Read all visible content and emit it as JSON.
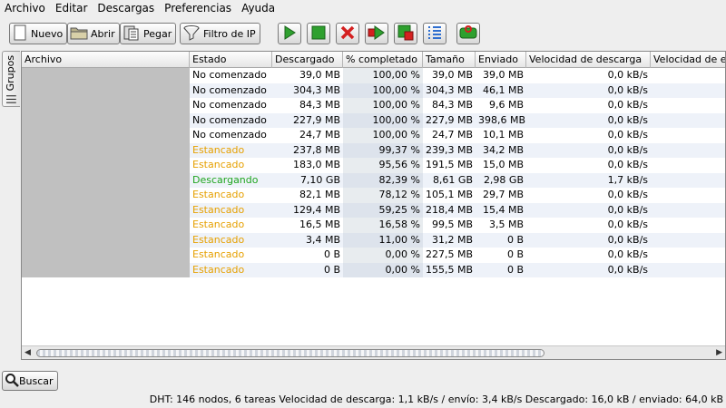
{
  "menu": {
    "items": [
      {
        "label": "Archivo"
      },
      {
        "label": "Editar"
      },
      {
        "label": "Descargas"
      },
      {
        "label": "Preferencias"
      },
      {
        "label": "Ayuda"
      }
    ]
  },
  "toolbar": {
    "new_label": "Nuevo",
    "open_label": "Abrir",
    "paste_label": "Pegar",
    "ipfilter_label": "Filtro de IP",
    "icons": [
      "start-icon",
      "stop-icon",
      "remove-icon",
      "step-icon",
      "pause-icon",
      "details-icon",
      "on-off-icon"
    ]
  },
  "side_tab": {
    "label": "Grupos"
  },
  "table": {
    "columns": [
      "Archivo",
      "Estado",
      "Descargado",
      "% completado",
      "Tamaño",
      "Enviado",
      "Velocidad de descarga",
      "Velocidad de e"
    ],
    "rows": [
      {
        "file": "",
        "status": "No comenzado",
        "status_type": "idle",
        "downloaded": "39,0 MB",
        "pct": "100,00 %",
        "size": "39,0 MB",
        "sent": "39,0 MB",
        "dlspeed": "0,0 kB/s",
        "ulspeed": "0,"
      },
      {
        "file": "",
        "status": "No comenzado",
        "status_type": "idle",
        "downloaded": "304,3 MB",
        "pct": "100,00 %",
        "size": "304,3 MB",
        "sent": "46,1 MB",
        "dlspeed": "0,0 kB/s",
        "ulspeed": "0,"
      },
      {
        "file": "",
        "status": "No comenzado",
        "status_type": "idle",
        "downloaded": "84,3 MB",
        "pct": "100,00 %",
        "size": "84,3 MB",
        "sent": "9,6 MB",
        "dlspeed": "0,0 kB/s",
        "ulspeed": "0,"
      },
      {
        "file": "",
        "status": "No comenzado",
        "status_type": "idle",
        "downloaded": "227,9 MB",
        "pct": "100,00 %",
        "size": "227,9 MB",
        "sent": "398,6 MB",
        "dlspeed": "0,0 kB/s",
        "ulspeed": "0,"
      },
      {
        "file": "",
        "status": "No comenzado",
        "status_type": "idle",
        "downloaded": "24,7 MB",
        "pct": "100,00 %",
        "size": "24,7 MB",
        "sent": "10,1 MB",
        "dlspeed": "0,0 kB/s",
        "ulspeed": "0,"
      },
      {
        "file": "",
        "status": "Estancado",
        "status_type": "stalled",
        "downloaded": "237,8 MB",
        "pct": "99,37 %",
        "size": "239,3 MB",
        "sent": "34,2 MB",
        "dlspeed": "0,0 kB/s",
        "ulspeed": "0,"
      },
      {
        "file": "",
        "status": "Estancado",
        "status_type": "stalled",
        "downloaded": "183,0 MB",
        "pct": "95,56 %",
        "size": "191,5 MB",
        "sent": "15,0 MB",
        "dlspeed": "0,0 kB/s",
        "ulspeed": "0,"
      },
      {
        "file": "",
        "status": "Descargando",
        "status_type": "down",
        "downloaded": "7,10 GB",
        "pct": "82,39 %",
        "size": "8,61 GB",
        "sent": "2,98 GB",
        "dlspeed": "1,7 kB/s",
        "ulspeed": "3,"
      },
      {
        "file": "",
        "status": "Estancado",
        "status_type": "stalled",
        "downloaded": "82,1 MB",
        "pct": "78,12 %",
        "size": "105,1 MB",
        "sent": "29,7 MB",
        "dlspeed": "0,0 kB/s",
        "ulspeed": "0,"
      },
      {
        "file": "",
        "status": "Estancado",
        "status_type": "stalled",
        "downloaded": "129,4 MB",
        "pct": "59,25 %",
        "size": "218,4 MB",
        "sent": "15,4 MB",
        "dlspeed": "0,0 kB/s",
        "ulspeed": "0,"
      },
      {
        "file": "",
        "status": "Estancado",
        "status_type": "stalled",
        "downloaded": "16,5 MB",
        "pct": "16,58 %",
        "size": "99,5 MB",
        "sent": "3,5 MB",
        "dlspeed": "0,0 kB/s",
        "ulspeed": "0,"
      },
      {
        "file": "",
        "status": "Estancado",
        "status_type": "stalled",
        "downloaded": "3,4 MB",
        "pct": "11,00 %",
        "size": "31,2 MB",
        "sent": "0 B",
        "dlspeed": "0,0 kB/s",
        "ulspeed": "0,"
      },
      {
        "file": "",
        "status": "Estancado",
        "status_type": "stalled",
        "downloaded": "0 B",
        "pct": "0,00 %",
        "size": "227,5 MB",
        "sent": "0 B",
        "dlspeed": "0,0 kB/s",
        "ulspeed": "0,"
      },
      {
        "file": "",
        "status": "Estancado",
        "status_type": "stalled",
        "downloaded": "0 B",
        "pct": "0,00 %",
        "size": "155,5 MB",
        "sent": "0 B",
        "dlspeed": "0,0 kB/s",
        "ulspeed": "0,"
      }
    ]
  },
  "search": {
    "label": "Buscar"
  },
  "status": {
    "text": "DHT: 146 nodos, 6 tareas Velocidad de descarga: 1,1 kB/s / envío: 3,4 kB/s Descargado: 16,0 kB / enviado: 64,0 kB"
  },
  "colors": {
    "stalled": "#e6a000",
    "downloading": "#1fa51f",
    "start": "#2ea02e",
    "remove": "#d42020"
  }
}
